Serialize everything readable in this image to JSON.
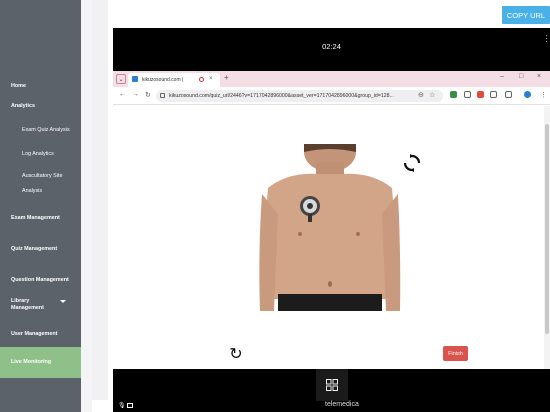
{
  "sidebar": {
    "items": [
      {
        "label": "Home"
      },
      {
        "label": "Analytics"
      },
      {
        "label": "Exam Quiz Analysis"
      },
      {
        "label": "Log Analytics"
      },
      {
        "label": "Auscultatory Site"
      },
      {
        "label": "Analysis"
      },
      {
        "label": "Exam Management"
      },
      {
        "label": "Quiz Management"
      },
      {
        "label": "Question Management"
      },
      {
        "label": "Library"
      },
      {
        "label": "Management"
      },
      {
        "label": "User Management"
      },
      {
        "label": "Live Monitoring"
      }
    ],
    "colors": {
      "background": "#5b6269",
      "active": "#8fc08a"
    }
  },
  "header": {
    "copy_url_label": "COPY URL"
  },
  "video": {
    "timer": "02:24",
    "brand": "telemedica"
  },
  "browser": {
    "tab_title": "kikuzosound.com |",
    "url": "kikuzosound.com/quiz_url/2446?v=1717042896000&asset_ver=1717042896000&group_id=128...",
    "finish_label": "Finish"
  },
  "icons": [
    "chevron-down-icon",
    "kebab-menu-icon",
    "refresh-icon",
    "sync-icon",
    "grid-icon",
    "mic-off-icon",
    "camera-icon"
  ]
}
